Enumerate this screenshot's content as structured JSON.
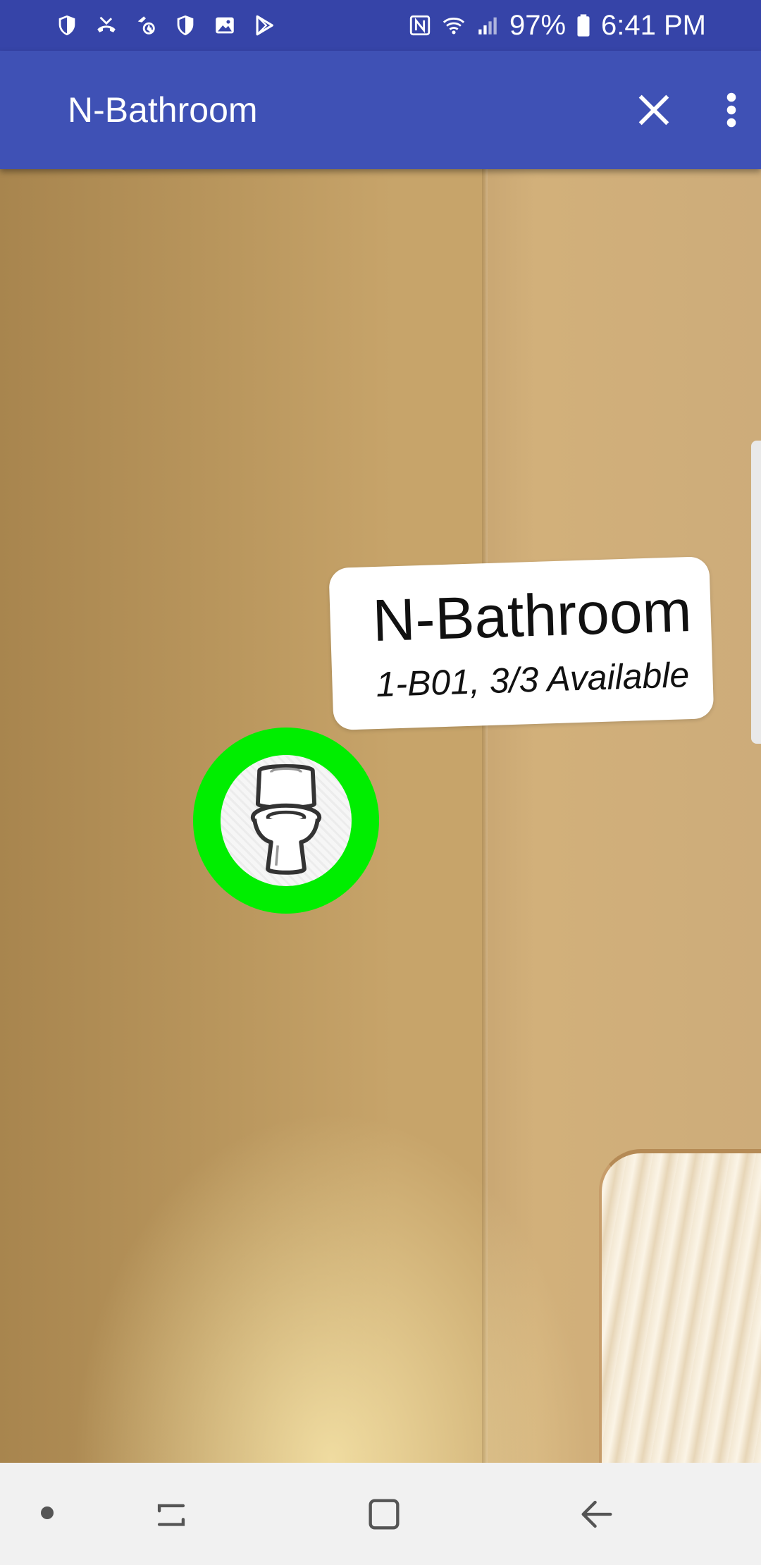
{
  "status_bar": {
    "battery": "97%",
    "time": "6:41 PM",
    "left_icons": [
      "shield-icon",
      "missed-call-icon",
      "data-sync-icon",
      "shield-icon",
      "image-icon",
      "play-store-icon"
    ],
    "right_icons": [
      "nfc-icon",
      "wifi-icon",
      "signal-icon",
      "battery-icon"
    ]
  },
  "app_bar": {
    "title": "N-Bathroom",
    "close_icon": "close-icon",
    "more_icon": "more-vert-icon"
  },
  "ar_marker": {
    "icon": "toilet-icon",
    "title": "N-Bathroom",
    "subtitle": "1-B01, 3/3 Available",
    "status_color": "#00ee00"
  },
  "nav_bar": {
    "icons": [
      "indicator-dot-icon",
      "recent-apps-icon",
      "home-icon",
      "back-icon"
    ]
  },
  "colors": {
    "status_bar": "#3644a8",
    "app_bar": "#3f51b5",
    "nav_bar": "#f1f1f1"
  }
}
